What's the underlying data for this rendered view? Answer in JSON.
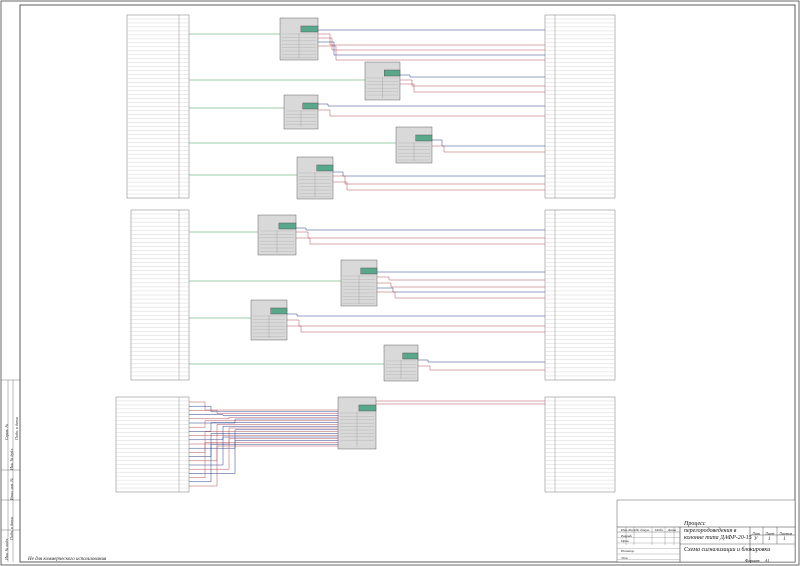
{
  "sheet": {
    "left_strip": [
      "Справ. №",
      "Перв. примен.",
      "Подп. и дата",
      "Инв. № дубл.",
      "Взам. инв. №",
      "Подп. и дата",
      "Инв. № подл."
    ],
    "bottom_caption": "Не для коммерческого использования",
    "format_label": "Формат",
    "format_value": "A1"
  },
  "stamp": {
    "title_main": "Процесс перегородоведения в колонне типа ДАФР-20-15",
    "title_sub": "Схема сигнализации и блокировки",
    "col_headers": [
      "Изм.",
      "Лист",
      "№ докум.",
      "Подп.",
      "Дата"
    ],
    "rows": [
      "Разраб.",
      "Пров.",
      "Т.контр.",
      "",
      "Н.контр.",
      "Утв."
    ],
    "lit_header": "Лит.",
    "sheet_header": "Лист",
    "sheets_header": "Листов",
    "lit_value": "У",
    "sheet_value": "1",
    "sheets_value": "1"
  },
  "colors": {
    "line_red": "#b0505a",
    "line_green": "#3f9a55",
    "line_blue": "#2a3f8a",
    "block_header": "#5aa88c",
    "block_body": "#d9d9d9"
  }
}
